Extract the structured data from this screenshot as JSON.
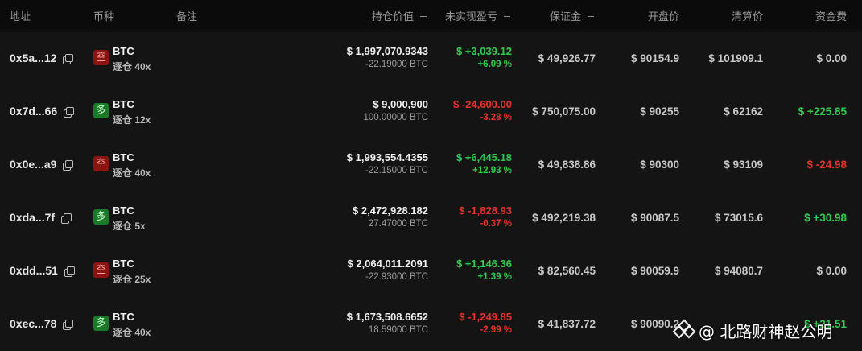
{
  "header": {
    "address": "地址",
    "coin": "币种",
    "note": "备注",
    "position_value": "持仓价值",
    "unrealized_pnl": "未实现盈亏",
    "margin": "保证金",
    "open_price": "开盘价",
    "liq_price": "清算价",
    "funding": "资金费"
  },
  "rows": [
    {
      "address": "0x5a...12",
      "side": "空",
      "side_type": "short",
      "coin": "BTC",
      "leverage": "逐仓 40x",
      "value": "$ 1,997,070.9343",
      "size": "-22.19000 BTC",
      "pnl": "$ +3,039.12",
      "pnl_pct": "+6.09 %",
      "pnl_sign": "pos",
      "margin": "$ 49,926.77",
      "open": "$ 90154.9",
      "liq": "$ 101909.1",
      "fee": "$ 0.00",
      "fee_sign": "neu"
    },
    {
      "address": "0x7d...66",
      "side": "多",
      "side_type": "long",
      "coin": "BTC",
      "leverage": "逐仓 12x",
      "value": "$ 9,000,900",
      "size": "100.00000 BTC",
      "pnl": "$ -24,600.00",
      "pnl_pct": "-3.28 %",
      "pnl_sign": "neg",
      "margin": "$ 750,075.00",
      "open": "$ 90255",
      "liq": "$ 62162",
      "fee": "$ +225.85",
      "fee_sign": "pos"
    },
    {
      "address": "0x0e...a9",
      "side": "空",
      "side_type": "short",
      "coin": "BTC",
      "leverage": "逐仓 40x",
      "value": "$ 1,993,554.4355",
      "size": "-22.15000 BTC",
      "pnl": "$ +6,445.18",
      "pnl_pct": "+12.93 %",
      "pnl_sign": "pos",
      "margin": "$ 49,838.86",
      "open": "$ 90300",
      "liq": "$ 93109",
      "fee": "$ -24.98",
      "fee_sign": "neg"
    },
    {
      "address": "0xda...7f",
      "side": "多",
      "side_type": "long",
      "coin": "BTC",
      "leverage": "逐仓 5x",
      "value": "$ 2,472,928.182",
      "size": "27.47000 BTC",
      "pnl": "$ -1,828.93",
      "pnl_pct": "-0.37 %",
      "pnl_sign": "neg",
      "margin": "$ 492,219.38",
      "open": "$ 90087.5",
      "liq": "$ 73015.6",
      "fee": "$ +30.98",
      "fee_sign": "pos"
    },
    {
      "address": "0xdd...51",
      "side": "空",
      "side_type": "short",
      "coin": "BTC",
      "leverage": "逐仓 25x",
      "value": "$ 2,064,011.2091",
      "size": "-22.93000 BTC",
      "pnl": "$ +1,146.36",
      "pnl_pct": "+1.39 %",
      "pnl_sign": "pos",
      "margin": "$ 82,560.45",
      "open": "$ 90059.9",
      "liq": "$ 94080.7",
      "fee": "$ 0.00",
      "fee_sign": "neu"
    },
    {
      "address": "0xec...78",
      "side": "多",
      "side_type": "long",
      "coin": "BTC",
      "leverage": "逐仓 40x",
      "value": "$ 1,673,508.6652",
      "size": "18.59000 BTC",
      "pnl": "$ -1,249.85",
      "pnl_pct": "-2.99 %",
      "pnl_sign": "neg",
      "margin": "$ 41,837.72",
      "open": "$ 90090.2",
      "liq": "",
      "fee": "$ +21.51",
      "fee_sign": "pos"
    }
  ],
  "watermark": "@ 北路财神赵公明",
  "colors": {
    "positive": "#2ecc50",
    "negative": "#e8322c",
    "short_badge": "#8b1410",
    "long_badge": "#1a7a2a"
  }
}
